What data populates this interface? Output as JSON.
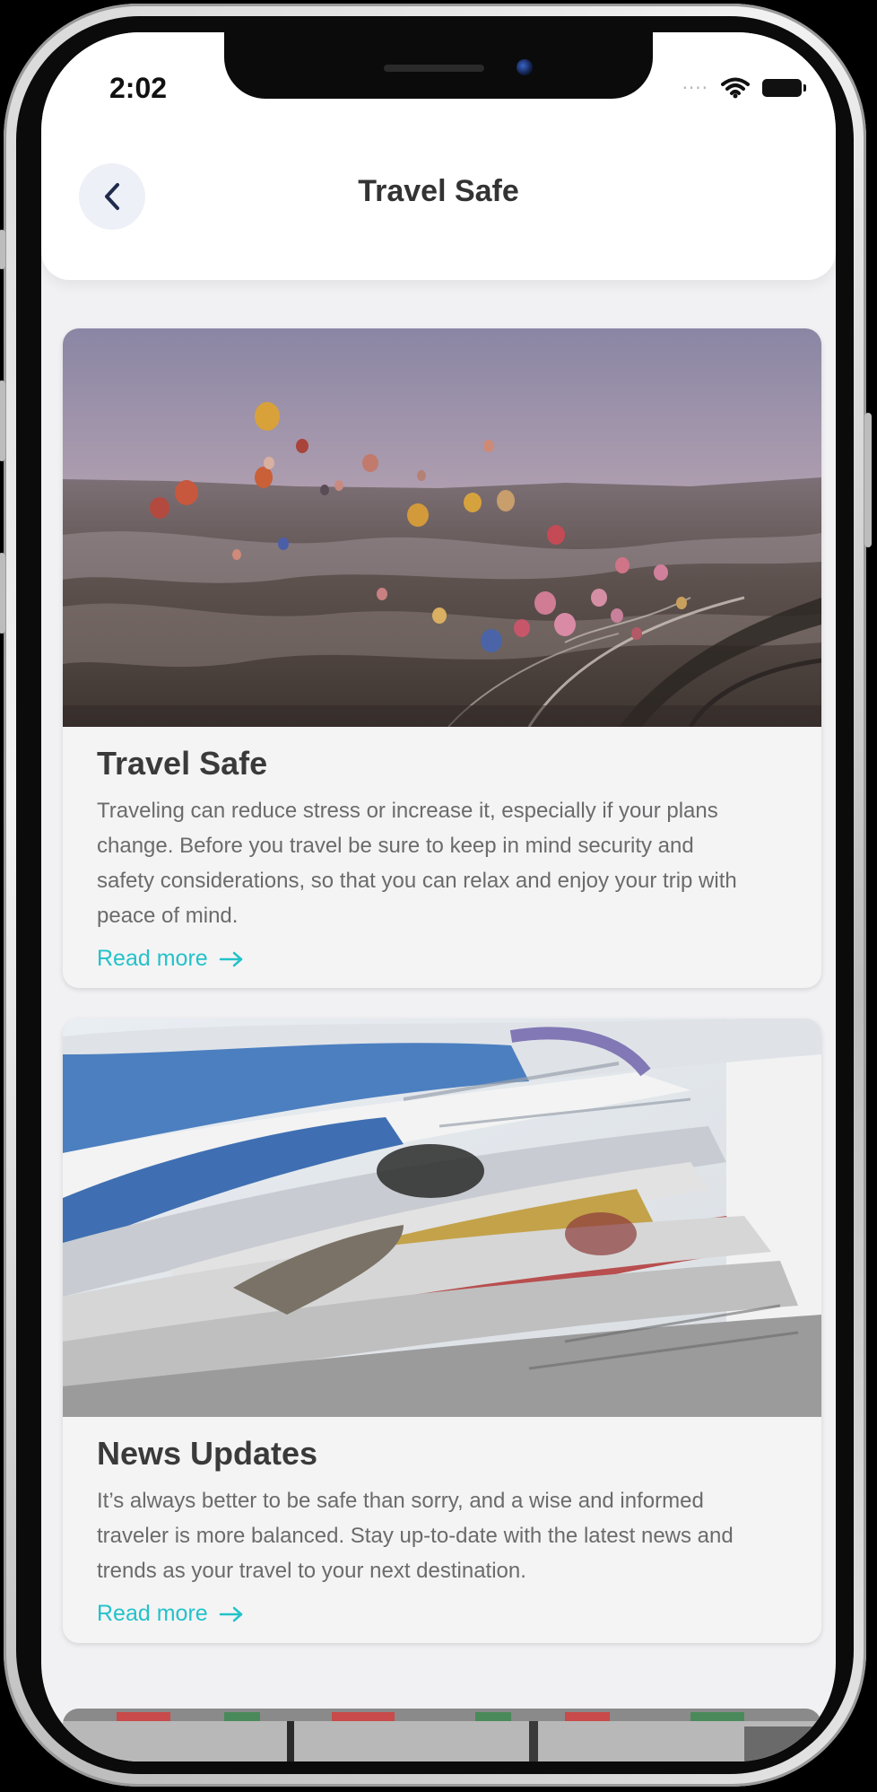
{
  "status_bar": {
    "time": "2:02",
    "signal_icon": "signal-dots-icon",
    "wifi_icon": "wifi-icon",
    "battery_icon": "battery-icon"
  },
  "header": {
    "title": "Travel Safe",
    "back_icon": "chevron-left-icon"
  },
  "articles": [
    {
      "title": "Travel Safe",
      "body": "Traveling can reduce stress or increase it, especially if your plans change. Before you travel be sure to keep in mind security and safety considerations, so that you can relax and enjoy your trip with peace of mind.",
      "link_label": "Read more",
      "link_icon": "arrow-right-icon",
      "image": "hot-air-balloons-photo"
    },
    {
      "title": "News Updates",
      "body": "It’s always better to be safe than sorry, and a wise and informed traveler is more balanced. Stay up-to-date with the latest news and trends as your travel to your next destination.",
      "link_label": "Read more",
      "link_icon": "arrow-right-icon",
      "image": "newspapers-photo"
    }
  ],
  "colors": {
    "accent": "#23c2c9",
    "title_text": "#3a3a3a",
    "body_text": "#6b6b6b",
    "background": "#f1f1f3"
  }
}
